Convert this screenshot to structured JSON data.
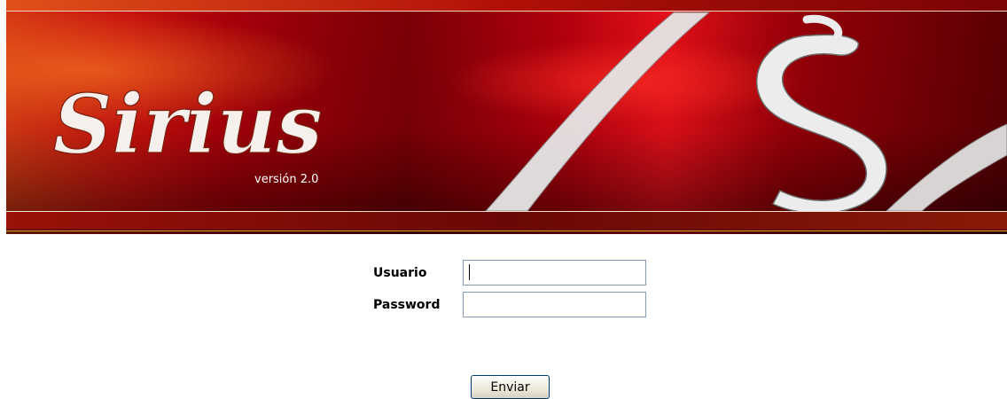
{
  "banner": {
    "logo_text": "Sirius",
    "version_text": "versión 2.0",
    "monogram_text": "S"
  },
  "form": {
    "username_label": "Usuario",
    "username_value": "",
    "password_label": "Password",
    "password_value": "",
    "submit_label": "Enviar"
  },
  "colors": {
    "banner_red": "#c8000f",
    "banner_dark": "#4a0000",
    "banner_orange": "#e84a1a",
    "input_border": "#7f9db9"
  }
}
